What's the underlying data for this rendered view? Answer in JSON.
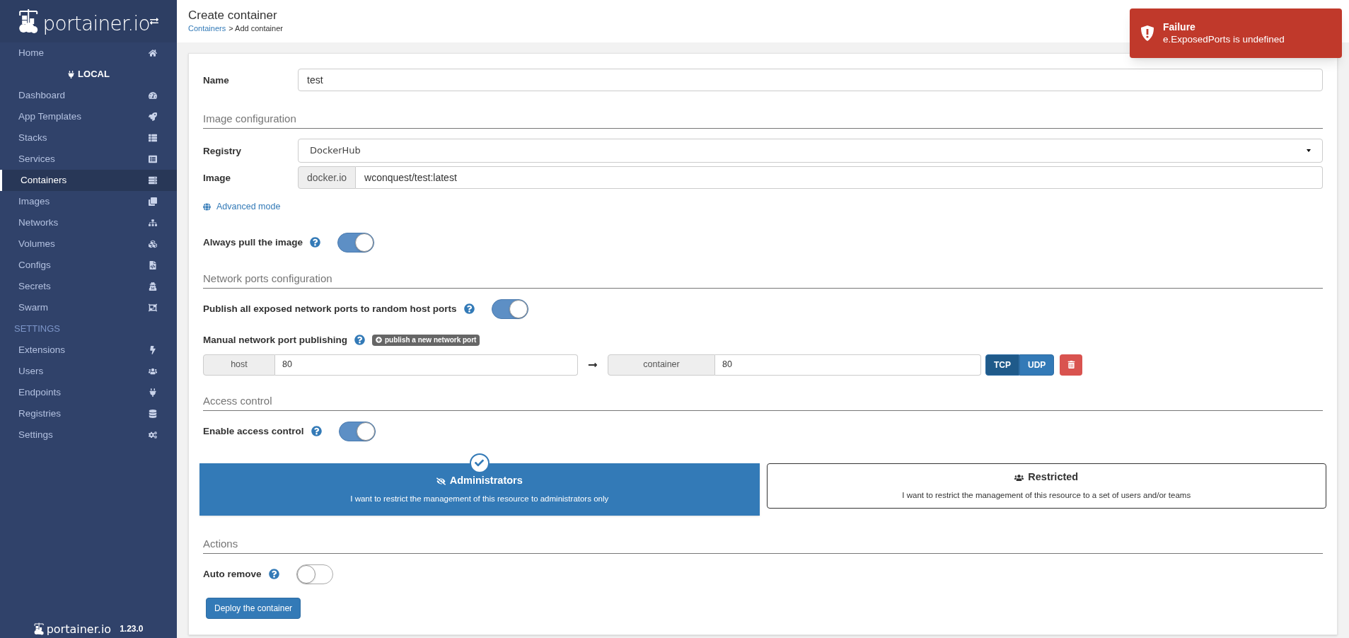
{
  "sidebar": {
    "logo_text": "portainer.io",
    "items": [
      {
        "kind": "link",
        "label": "Home",
        "selected": false
      },
      {
        "kind": "endpoint",
        "label": "LOCAL"
      },
      {
        "kind": "link",
        "label": "Dashboard",
        "selected": false
      },
      {
        "kind": "link",
        "label": "App Templates",
        "selected": false
      },
      {
        "kind": "link",
        "label": "Stacks",
        "selected": false
      },
      {
        "kind": "link",
        "label": "Services",
        "selected": false
      },
      {
        "kind": "link",
        "label": "Containers",
        "selected": true
      },
      {
        "kind": "link",
        "label": "Images",
        "selected": false
      },
      {
        "kind": "link",
        "label": "Networks",
        "selected": false
      },
      {
        "kind": "link",
        "label": "Volumes",
        "selected": false
      },
      {
        "kind": "link",
        "label": "Configs",
        "selected": false
      },
      {
        "kind": "link",
        "label": "Secrets",
        "selected": false
      },
      {
        "kind": "link",
        "label": "Swarm",
        "selected": false
      },
      {
        "kind": "section",
        "label": "SETTINGS"
      },
      {
        "kind": "link",
        "label": "Extensions",
        "selected": false
      },
      {
        "kind": "link",
        "label": "Users",
        "selected": false
      },
      {
        "kind": "link",
        "label": "Endpoints",
        "selected": false
      },
      {
        "kind": "link",
        "label": "Registries",
        "selected": false
      },
      {
        "kind": "link",
        "label": "Settings",
        "selected": false
      }
    ],
    "footer": {
      "logo_text": "portainer.io",
      "version": "1.23.0"
    }
  },
  "header": {
    "title": "Create container",
    "breadcrumb_link": "Containers",
    "breadcrumb_rest": "> Add container"
  },
  "toast": {
    "title": "Failure",
    "message": "e.ExposedPorts is undefined"
  },
  "form": {
    "name": {
      "label": "Name",
      "value": "test"
    },
    "image_heading": "Image configuration",
    "registry": {
      "label": "Registry",
      "value": "DockerHub"
    },
    "image": {
      "label": "Image",
      "prefix": "docker.io",
      "value": "wconquest/test:latest"
    },
    "advanced_link": "Advanced mode",
    "always_pull": {
      "label": "Always pull the image",
      "on": true
    },
    "network_heading": "Network ports configuration",
    "publish_all": {
      "label": "Publish all exposed network ports to random host ports",
      "on": true
    },
    "manual": {
      "label": "Manual network port publishing",
      "add_button": "publish a new network port"
    },
    "ports": [
      {
        "host_label": "host",
        "host": "80",
        "container_label": "container",
        "container": "80",
        "protocols": [
          {
            "label": "TCP",
            "selected": true
          },
          {
            "label": "UDP",
            "selected": false
          }
        ]
      }
    ],
    "access_heading": "Access control",
    "access_control": {
      "label": "Enable access control",
      "on": true
    },
    "access_options": [
      {
        "kind": "admins",
        "title": "Administrators",
        "description": "I want to restrict the management of this resource to administrators only",
        "selected": true
      },
      {
        "kind": "restricted",
        "title": "Restricted",
        "description": "I want to restrict the management of this resource to a set of users and/or teams",
        "selected": false
      }
    ],
    "actions_heading": "Actions",
    "auto_remove": {
      "label": "Auto remove",
      "on": false
    },
    "deploy_button": "Deploy the container"
  }
}
